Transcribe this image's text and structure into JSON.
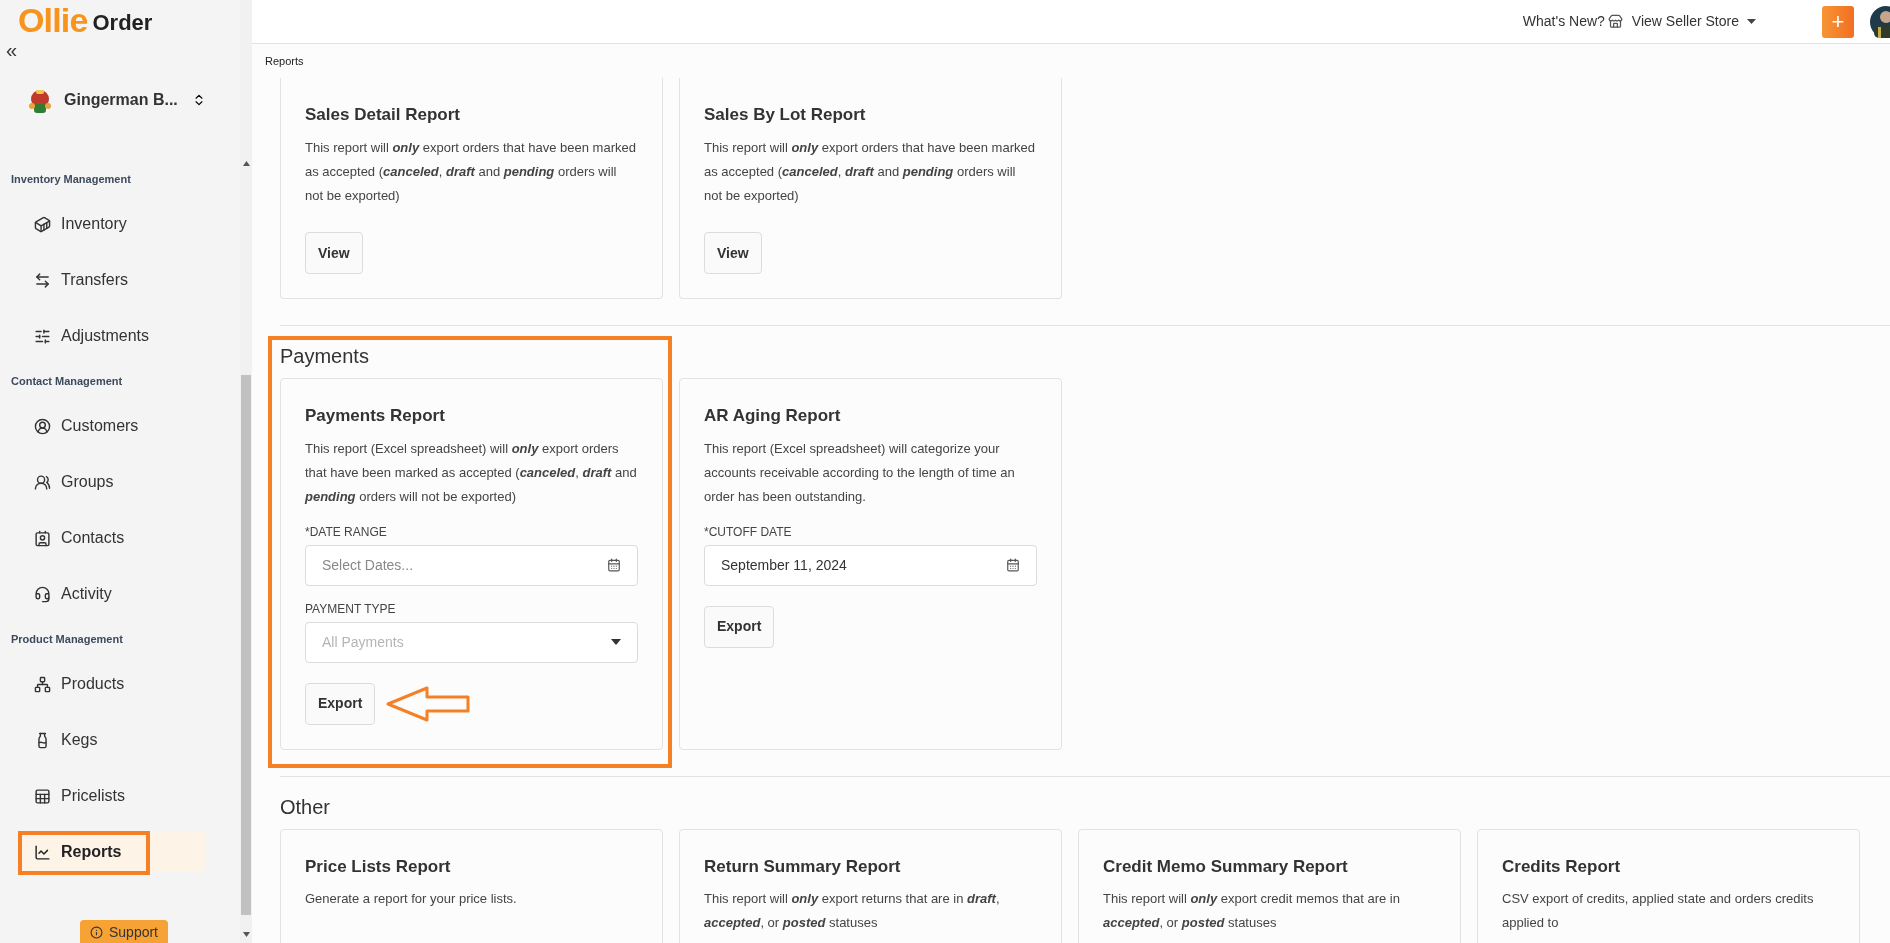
{
  "logo": {
    "brand": "Ollie",
    "product": "Order"
  },
  "sidebar": {
    "collapse": "«",
    "org": {
      "name": "Gingerman B..."
    },
    "sections": [
      {
        "title": "Inventory Management",
        "items": [
          {
            "label": "Inventory",
            "selected": false
          },
          {
            "label": "Transfers",
            "selected": false
          },
          {
            "label": "Adjustments",
            "selected": false
          }
        ]
      },
      {
        "title": "Contact Management",
        "items": [
          {
            "label": "Customers",
            "selected": false
          },
          {
            "label": "Groups",
            "selected": false
          },
          {
            "label": "Contacts",
            "selected": false
          },
          {
            "label": "Activity",
            "selected": false
          }
        ]
      },
      {
        "title": "Product Management",
        "items": [
          {
            "label": "Products",
            "selected": false
          },
          {
            "label": "Kegs",
            "selected": false
          },
          {
            "label": "Pricelists",
            "selected": false
          },
          {
            "label": "Reports",
            "selected": true,
            "highlighted": true
          }
        ]
      }
    ],
    "support": "Support"
  },
  "topbar": {
    "whats_new": "What's New?",
    "seller_store": "View Seller Store",
    "add": "+"
  },
  "breadcrumb": "Reports",
  "sections": [
    {
      "cards": [
        {
          "title": "Sales Detail Report",
          "description": "This report will **only** export orders that have been marked as accepted (**canceled**, **draft** and **pending** orders will not be exported)",
          "button": {
            "label": "View"
          }
        },
        {
          "title": "Sales By Lot Report",
          "description": "This report will **only** export orders that have been marked as accepted (**canceled**, **draft** and **pending** orders will not be exported)",
          "button": {
            "label": "View"
          }
        }
      ]
    },
    {
      "title": "Payments",
      "highlighted": true,
      "cards": [
        {
          "title": "Payments Report",
          "description": "This report (Excel spreadsheet) will **only** export orders that have been marked as accepted (**canceled**, **draft** and **pending** orders will not be exported)",
          "fields": [
            {
              "kind": "date",
              "label": "*DATE RANGE",
              "placeholder": "Select Dates..."
            },
            {
              "kind": "select",
              "label": "PAYMENT TYPE",
              "placeholder": "All Payments"
            }
          ],
          "button": {
            "label": "Export",
            "pointed": true
          }
        },
        {
          "title": "AR Aging Report",
          "description": "This report (Excel spreadsheet) will categorize your accounts receivable according to the length of time an order has been outstanding.",
          "fields": [
            {
              "kind": "date",
              "label": "*CUTOFF DATE",
              "value": "September 11, 2024"
            }
          ],
          "button": {
            "label": "Export"
          }
        }
      ]
    },
    {
      "title": "Other",
      "cards": [
        {
          "title": "Price Lists Report",
          "description": "Generate a report for your price lists."
        },
        {
          "title": "Return Summary Report",
          "description": "This report will **only** export returns that are in **draft**, **accepted**, or **posted** statuses"
        },
        {
          "title": "Credit Memo Summary Report",
          "description": "This report will **only** export credit memos that are in **accepted**, or **posted** statuses"
        },
        {
          "title": "Credits Report",
          "description": "CSV export of credits, applied state and orders credits applied to"
        }
      ]
    }
  ]
}
